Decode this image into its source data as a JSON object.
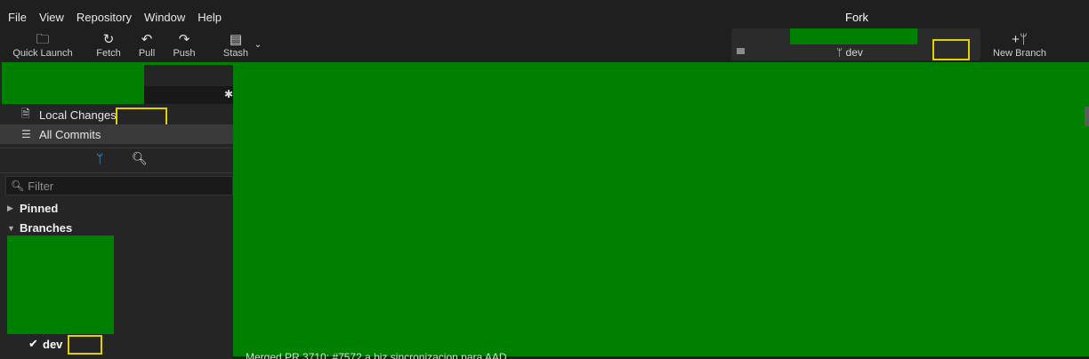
{
  "menu": {
    "items": [
      "File",
      "View",
      "Repository",
      "Window",
      "Help"
    ]
  },
  "app": {
    "title": "Fork"
  },
  "toolbar": {
    "quick_launch": "Quick Launch",
    "fetch": "Fetch",
    "pull": "Pull",
    "push": "Push",
    "stash": "Stash",
    "new_branch": "New Branch"
  },
  "current_branch": {
    "name": "dev"
  },
  "sidebar": {
    "local_changes": "Local Changes",
    "all_commits": "All Commits",
    "filter_placeholder": "Filter",
    "pinned": "Pinned",
    "branches": "Branches",
    "active_branch": "dev"
  },
  "commit_list": {
    "partial_row": "Merged PR 3710: #7572 a biz sincronizacion para AAD"
  },
  "colors": {
    "redaction_green": "#008000",
    "highlight_yellow": "#e2d100",
    "accent_blue": "#4aa3ff"
  }
}
